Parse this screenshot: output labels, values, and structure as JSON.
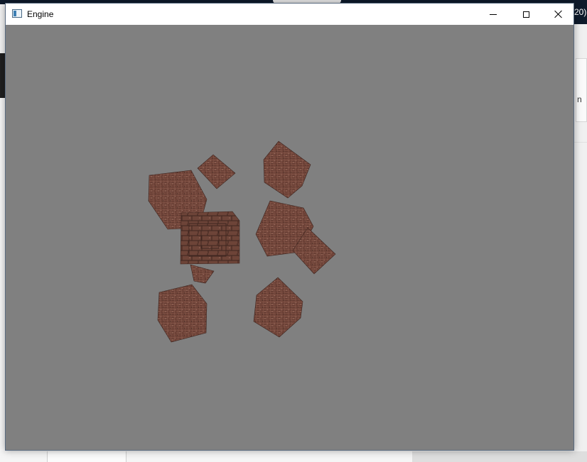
{
  "window": {
    "title": "Engine",
    "background_color": "#808080",
    "controls": [
      "minimize-icon",
      "maximize-icon",
      "close-icon"
    ]
  },
  "background": {
    "right_edge_text": "20)",
    "right_edge_letter": "n"
  },
  "scene": {
    "object_type": "textured cube",
    "texture_color": "#7a4b3f",
    "cube_count": 10
  }
}
